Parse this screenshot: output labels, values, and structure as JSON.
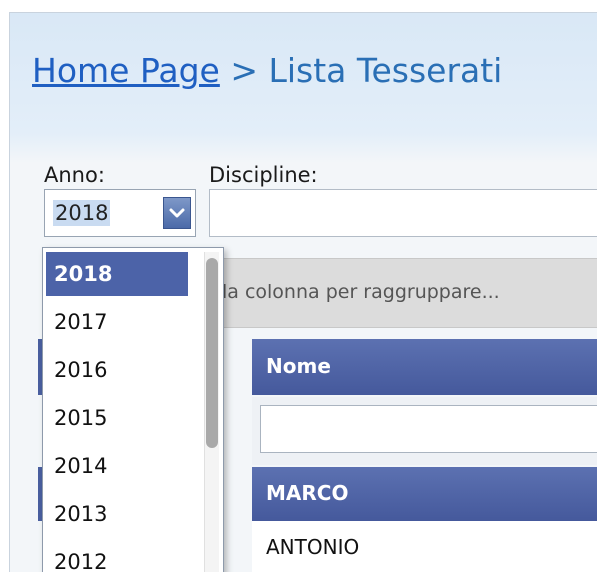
{
  "breadcrumb": {
    "home": "Home Page",
    "separator": ">",
    "current": "Lista Tesserati"
  },
  "filters": {
    "anno_label": "Anno:",
    "anno_value": "2018",
    "discipline_label": "Discipline:",
    "discipline_value": ""
  },
  "dropdown": {
    "options": [
      "2018",
      "2017",
      "2016",
      "2015",
      "2014",
      "2013",
      "2012"
    ],
    "selected": "2018"
  },
  "grid": {
    "group_hint": "la colonna per raggruppare...",
    "columns": [
      "Nome"
    ],
    "rows": [
      "MARCO",
      "ANTONIO"
    ],
    "selected_row": "MARCO"
  },
  "colors": {
    "accent": "#4c63a8",
    "link": "#1f5fc2"
  },
  "icons": {
    "combo_button": "chevron-down-icon"
  }
}
